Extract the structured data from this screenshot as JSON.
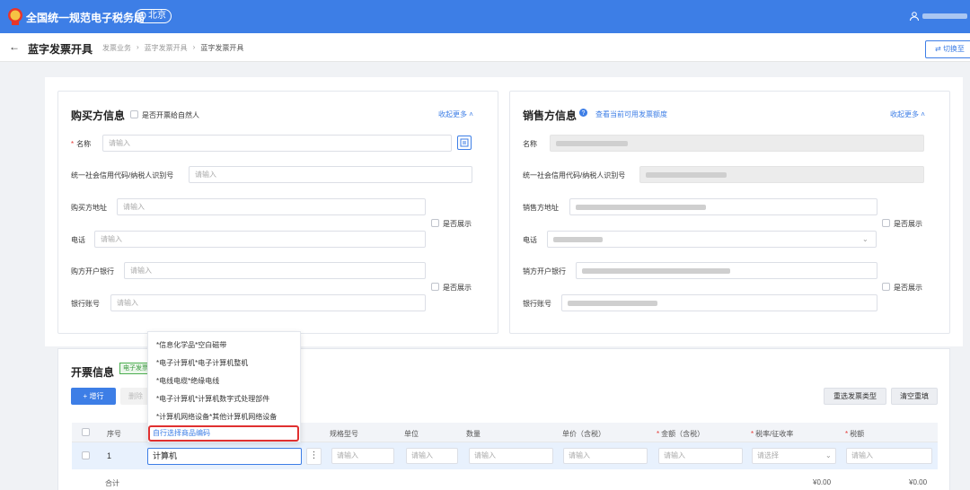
{
  "topbar": {
    "title": "全国统一规范电子税务局",
    "region": "北京",
    "accent": "#3d7ee6"
  },
  "header": {
    "back_icon": "←",
    "title": "蓝字发票开具",
    "breadcrumb": [
      "发票业务",
      "蓝字发票开具",
      "蓝字发票开具"
    ],
    "switch_label": "切换至"
  },
  "buyer": {
    "title": "购买方信息",
    "natural_person_label": "是否开票给自然人",
    "collapse_label": "收起更多",
    "fields": {
      "name_label": "名称",
      "name_placeholder": "请输入",
      "credit_code_label": "统一社会信用代码/纳税人识别号",
      "credit_code_placeholder": "请输入",
      "address_label": "购买方地址",
      "address_placeholder": "请输入",
      "phone_label": "电话",
      "phone_placeholder": "请输入",
      "bank_label": "购方开户银行",
      "bank_placeholder": "请输入",
      "account_label": "银行账号",
      "account_placeholder": "请输入"
    },
    "show_label_1": "是否展示",
    "show_label_2": "是否展示"
  },
  "seller": {
    "title": "销售方信息",
    "quota_link": "查看当前可用发票额度",
    "collapse_label": "收起更多",
    "fields": {
      "name_label": "名称",
      "credit_code_label": "统一社会信用代码/纳税人识别号",
      "address_label": "销售方地址",
      "phone_label": "电话",
      "bank_label": "销方开户银行",
      "account_label": "银行账号"
    },
    "show_label_1": "是否展示",
    "show_label_2": "是否展示"
  },
  "invoice": {
    "title": "开票信息",
    "badge": "电子发票",
    "add_row": "增行",
    "delete": "删除",
    "reselect_type": "重选发票类型",
    "clear_refill": "清空重填",
    "columns": {
      "index": "序号",
      "spec": "规格型号",
      "unit": "单位",
      "quantity": "数量",
      "unit_price": "单价（含税）",
      "amount": "金额（含税）",
      "tax_rate": "税率/征收率",
      "tax": "税额"
    },
    "row": {
      "index": "1",
      "item_name": "计算机",
      "more_icon": "⋮",
      "spec_placeholder": "请输入",
      "unit_placeholder": "请输入",
      "quantity_placeholder": "请输入",
      "unit_price_placeholder": "请输入",
      "amount_placeholder": "请输入",
      "tax_rate_placeholder": "请选择",
      "tax_placeholder": "请输入"
    },
    "total_label": "合计",
    "total_amount": "¥0.00",
    "total_tax": "¥0.00"
  },
  "suggestions": {
    "items": [
      "*信息化学品*空白磁带",
      "*电子计算机*电子计算机整机",
      "*电线电缆*绝缘电线",
      "*电子计算机*计算机数字式处理部件",
      "*计算机网络设备*其他计算机网络设备"
    ],
    "custom_select": "自行选择商品编码"
  }
}
